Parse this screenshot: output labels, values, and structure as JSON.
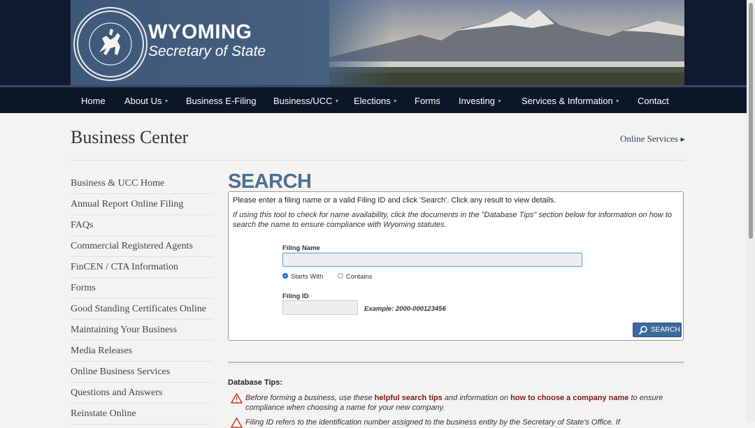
{
  "brand": {
    "title": "WYOMING",
    "subtitle": "Secretary of State"
  },
  "nav": {
    "items": [
      {
        "label": "Home",
        "dropdown": false
      },
      {
        "label": "About Us",
        "dropdown": true
      },
      {
        "label": "Business E-Filing",
        "dropdown": false
      },
      {
        "label": "Business/UCC",
        "dropdown": true
      },
      {
        "label": "Elections",
        "dropdown": true
      },
      {
        "label": "Forms",
        "dropdown": false
      },
      {
        "label": "Investing",
        "dropdown": true
      },
      {
        "label": "Services & Information",
        "dropdown": true
      },
      {
        "label": "Contact",
        "dropdown": false
      }
    ]
  },
  "page": {
    "title": "Business Center",
    "online_services": "Online Services"
  },
  "sidebar": {
    "items": [
      "Business & UCC Home",
      "Annual Report Online Filing",
      "FAQs",
      "Commercial Registered Agents",
      "FinCEN / CTA Information",
      "Forms",
      "Good Standing Certificates Online",
      "Maintaining Your Business",
      "Media Releases",
      "Online Business Services",
      "Questions and Answers",
      "Reinstate Online"
    ]
  },
  "search": {
    "heading": "SEARCH",
    "instruction": "Please enter a filing name or a valid Filing ID and click 'Search'. Click any result to view details.",
    "note": "If using this tool to check for name availability, click the documents in the \"Database Tips\" section below for information on how to search the name to ensure compliance with Wyoming statutes.",
    "filing_name_label": "Filing Name",
    "filing_name_value": "",
    "option_starts_with": "Starts With",
    "option_contains": "Contains",
    "selected_option": "Starts With",
    "filing_id_label": "Filing ID",
    "filing_id_value": "",
    "example": "Example: 2000-000123456",
    "button_label": "SEARCH"
  },
  "tips": {
    "heading": "Database Tips:",
    "tip1": {
      "before": "Before forming a business, use these ",
      "link1": "helpful search tips",
      "middle": " and information on ",
      "link2": "how to choose a company name",
      "after": " to ensure compliance when choosing a name for your new company."
    },
    "tip2": "Filing ID refers to the identification number assigned to the business entity by the Secretary of State's Office. If"
  },
  "colors": {
    "nav_bg": "#0b1729",
    "heading_blue": "#4d6f97",
    "button": "#3c6a9e",
    "link_red": "#7a1c1c",
    "focus": "#6fa7e6"
  }
}
